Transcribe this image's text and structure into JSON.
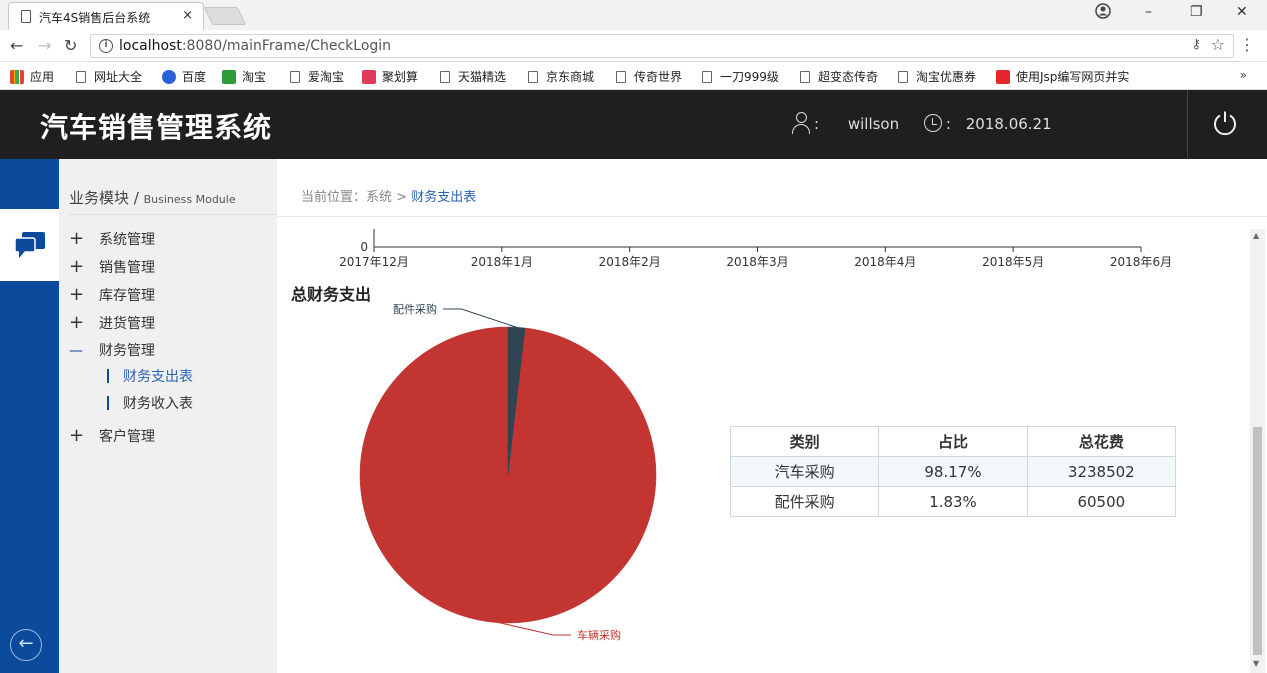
{
  "browser": {
    "tab_title": "汽车4S销售后台系统",
    "tab_close": "×",
    "url_host": "localhost",
    "url_rest": ":8080/mainFrame/CheckLogin",
    "bookmarks": [
      "应用",
      "网址大全",
      "百度",
      "淘宝",
      "爱淘宝",
      "聚划算",
      "天猫精选",
      "京东商城",
      "传奇世界",
      "一刀999级",
      "超变态传奇",
      "淘宝优惠券",
      "使用Jsp编写网页并实"
    ],
    "bookmarks_more": "»"
  },
  "header": {
    "title": "汽车销售管理系统",
    "user_label": ":",
    "username": "willson",
    "date_label": ":",
    "date": "2018.06.21"
  },
  "sidebar": {
    "module_title": "业务模块 / ",
    "module_subtitle": "Business Module",
    "items": [
      {
        "label": "系统管理",
        "symbol": "+"
      },
      {
        "label": "销售管理",
        "symbol": "+"
      },
      {
        "label": "库存管理",
        "symbol": "+"
      },
      {
        "label": "进货管理",
        "symbol": "+"
      },
      {
        "label": "财务管理",
        "symbol": "—"
      },
      {
        "label": "客户管理",
        "symbol": "+"
      }
    ],
    "sub_items": [
      {
        "label": "财务支出表",
        "active": true
      },
      {
        "label": "财务收入表",
        "active": false
      }
    ]
  },
  "breadcrumb": {
    "prefix": "当前位置：",
    "parent": "系统",
    "sep": ">",
    "current": "财务支出表"
  },
  "line_axis": {
    "y_tick": "0",
    "x_ticks": [
      "2017年12月",
      "2018年1月",
      "2018年2月",
      "2018年3月",
      "2018年4月",
      "2018年5月",
      "2018年6月"
    ]
  },
  "section_title": "总财务支出",
  "chart_data": {
    "type": "pie",
    "title": "总财务支出",
    "slices": [
      {
        "label": "车辆采购",
        "value": 3238502,
        "percent": 98.17,
        "color": "#c23531"
      },
      {
        "label": "配件采购",
        "value": 60500,
        "percent": 1.83,
        "color": "#2f4554"
      }
    ],
    "legend": "none"
  },
  "table": {
    "headers": [
      "类别",
      "占比",
      "总花费"
    ],
    "rows": [
      [
        "汽车采购",
        "98.17%",
        "3238502"
      ],
      [
        "配件采购",
        "1.83%",
        "60500"
      ]
    ]
  }
}
